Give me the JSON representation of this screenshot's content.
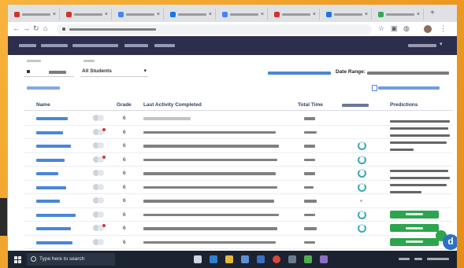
{
  "colors": {
    "page_frame": "#f0a12a",
    "app_header": "#2d2e4e",
    "link_blue": "#4a86d8",
    "gauge_teal": "#3aa6b9",
    "button_green": "#2ea44f",
    "alert_red": "#d6334a",
    "taskbar": "#1b2330"
  },
  "browser": {
    "tabs": [
      {
        "favicon_color": "#d93025"
      },
      {
        "favicon_color": "#d93025"
      },
      {
        "favicon_color": "#4285f4"
      },
      {
        "favicon_color": "#1a73e8"
      },
      {
        "favicon_color": "#4285f4"
      },
      {
        "favicon_color": "#d93025"
      },
      {
        "favicon_color": "#1a73e8"
      },
      {
        "favicon_color": "#34a853"
      }
    ],
    "new_tab": "+"
  },
  "filters": {
    "students": "All Students",
    "date_range_label": "Date Range:"
  },
  "table": {
    "headers": [
      "Name",
      "Grade",
      "Last Activity Completed",
      "Total Time",
      "Predictions"
    ],
    "rows": [
      {
        "grade": "6",
        "alert": false,
        "gauge": false,
        "button": false
      },
      {
        "grade": "6",
        "alert": true,
        "gauge": false,
        "button": false
      },
      {
        "grade": "6",
        "alert": false,
        "gauge": true,
        "button": false
      },
      {
        "grade": "6",
        "alert": true,
        "gauge": true,
        "button": false
      },
      {
        "grade": "6",
        "alert": false,
        "gauge": true,
        "button": false
      },
      {
        "grade": "6",
        "alert": false,
        "gauge": true,
        "button": false
      },
      {
        "grade": "6",
        "alert": false,
        "gauge": false,
        "button": false
      },
      {
        "grade": "6",
        "alert": false,
        "gauge": true,
        "button": true
      },
      {
        "grade": "6",
        "alert": true,
        "gauge": true,
        "button": true
      },
      {
        "grade": "6",
        "alert": false,
        "gauge": false,
        "button": true
      }
    ]
  },
  "widget": {
    "logo_letter": "d"
  },
  "taskbar": {
    "search_placeholder": "Type here to search"
  }
}
